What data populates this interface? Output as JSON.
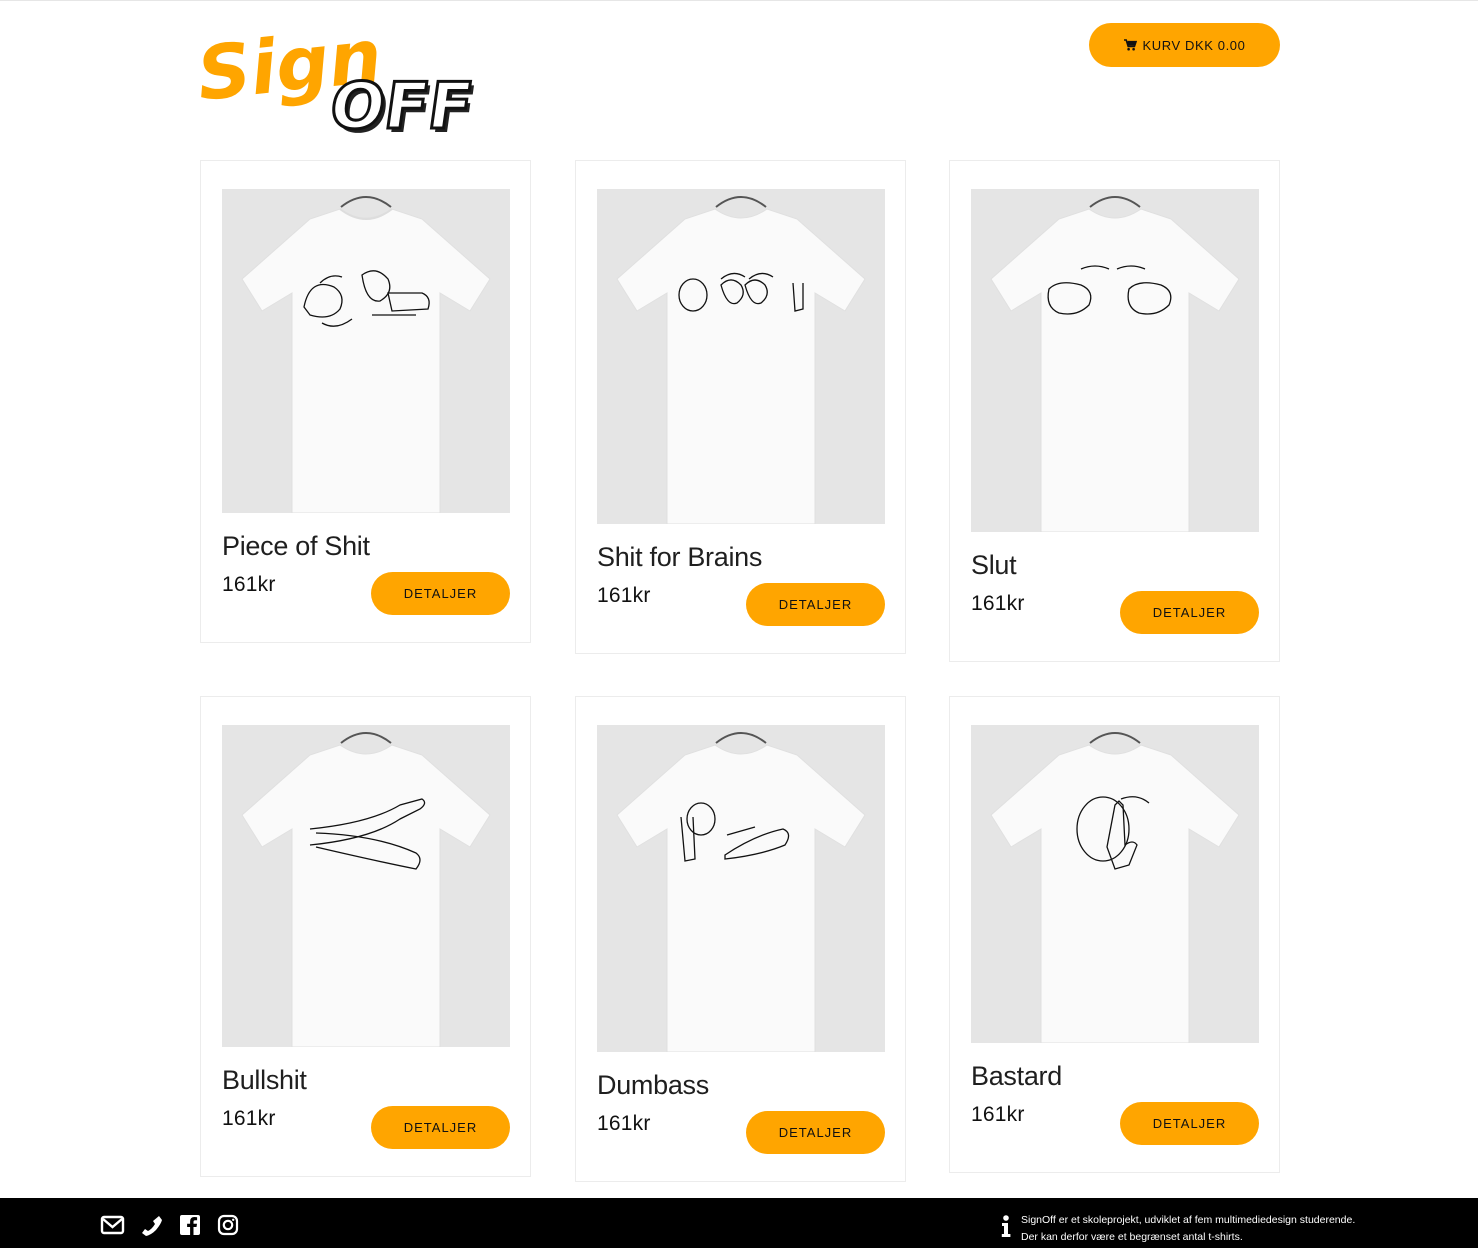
{
  "header": {
    "logo_text_top": "Sign",
    "logo_text_bottom": "OFF",
    "cart_label": "KURV DKK 0.00",
    "accent": "#ffa500"
  },
  "products": [
    {
      "title": "Piece of Shit",
      "price": "161kr",
      "button": "DETALJER"
    },
    {
      "title": "Shit for Brains",
      "price": "161kr",
      "button": "DETALJER"
    },
    {
      "title": "Slut",
      "price": "161kr",
      "button": "DETALJER"
    },
    {
      "title": "Bullshit",
      "price": "161kr",
      "button": "DETALJER"
    },
    {
      "title": "Dumbass",
      "price": "161kr",
      "button": "DETALJER"
    },
    {
      "title": "Bastard",
      "price": "161kr",
      "button": "DETALJER"
    }
  ],
  "footer": {
    "icons": [
      "envelope-icon",
      "phone-icon",
      "facebook-icon",
      "instagram-icon"
    ],
    "info_line1": "SignOff er et skoleprojekt, udviklet af fem multimediedesign studerende.",
    "info_line2": "Der kan derfor være et begrænset antal t-shirts."
  }
}
